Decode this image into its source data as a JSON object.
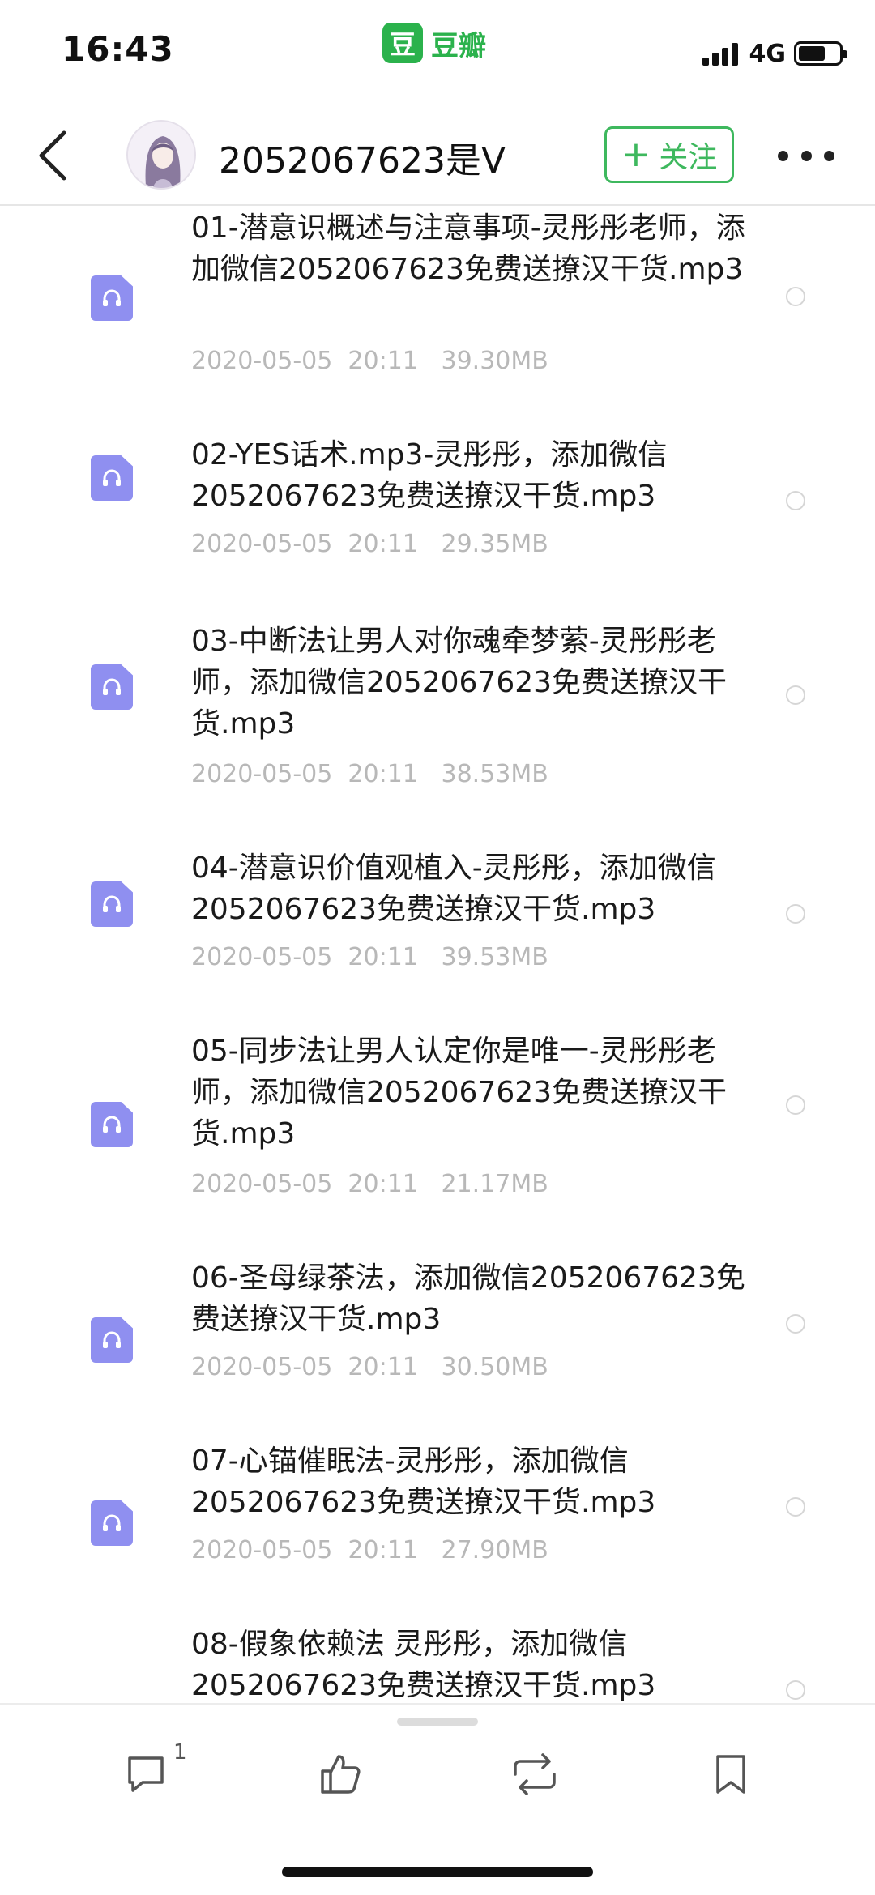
{
  "status_bar": {
    "time": "16:43",
    "app_logo_char": "豆",
    "app_name": "豆瓣",
    "network": "4G",
    "icons": [
      "signal-icon",
      "battery-icon"
    ]
  },
  "header": {
    "back_icon": "chevron-left-icon",
    "user_name": "2052067623是V",
    "follow_plus": "+",
    "follow_label": "关注",
    "more_icon": "more-dots-icon"
  },
  "files": [
    {
      "title": "01-潜意识概述与注意事项-灵彤彤老师，添加微信2052067623免费送撩汉干货.mp3",
      "meta": "2020-05-05  20:11   39.30MB"
    },
    {
      "title": "02-YES话术.mp3-灵彤彤，添加微信2052067623免费送撩汉干货.mp3",
      "meta": "2020-05-05  20:11   29.35MB"
    },
    {
      "title": "03-中断法让男人对你魂牵梦萦-灵彤彤老师，添加微信2052067623免费送撩汉干货.mp3",
      "meta": "2020-05-05  20:11   38.53MB"
    },
    {
      "title": "04-潜意识价值观植入-灵彤彤，添加微信2052067623免费送撩汉干货.mp3",
      "meta": "2020-05-05  20:11   39.53MB"
    },
    {
      "title": "05-同步法让男人认定你是唯一-灵彤彤老师，添加微信2052067623免费送撩汉干货.mp3",
      "meta": "2020-05-05  20:11   21.17MB"
    },
    {
      "title": "06-圣母绿茶法，添加微信2052067623免费送撩汉干货.mp3",
      "meta": "2020-05-05  20:11   30.50MB"
    },
    {
      "title": "07-心锚催眠法-灵彤彤，添加微信2052067623免费送撩汉干货.mp3",
      "meta": "2020-05-05  20:11   27.90MB"
    },
    {
      "title": "08-假象依赖法 灵彤彤，添加微信2052067623免费送撩汉干货.mp3",
      "meta": ""
    }
  ],
  "bottom_bar": {
    "comment_count": "1",
    "icons": [
      "comment-icon",
      "like-icon",
      "repost-icon",
      "bookmark-icon"
    ]
  },
  "colors": {
    "brand_green": "#2bb24c",
    "follow_green": "#3eb85e",
    "file_icon": "#8f8ff0",
    "meta_gray": "#b8b8b8"
  }
}
